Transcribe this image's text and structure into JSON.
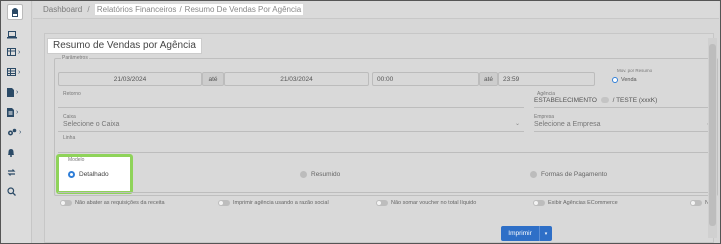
{
  "breadcrumb": {
    "root": "Dashboard",
    "separator": "/",
    "section": "Relatórios Financeiros",
    "current": "Resumo De Vendas Por Agência"
  },
  "page": {
    "title": "Resumo de Vendas por Agência"
  },
  "parametros": {
    "legend": "Parâmetros",
    "date_from": "21/03/2024",
    "date_sep": "até",
    "date_to": "21/03/2024",
    "time_from": "00:00",
    "time_sep": "até",
    "time_to": "23:59",
    "mov_legend": "Mov. por Resumo",
    "mov_option": "Venda",
    "retorno_label": "Retorno",
    "agencia_label": "Agência",
    "agencia_value": "ESTABELECIMENTO",
    "agencia_suffix": "/ TESTE (xxxK)",
    "caixa_label": "Caixa",
    "caixa_placeholder": "Selecione o Caixa",
    "empresa_label": "Empresa",
    "empresa_placeholder": "Selecione a Empresa",
    "linha_label": "Linha"
  },
  "modelo": {
    "legend": "Modelo",
    "options": [
      "Detalhado",
      "Resumido",
      "Formas de Pagamento"
    ],
    "selected": "Detalhado"
  },
  "toggles": [
    "Não abater as requisições da receita",
    "Imprimir agência usando a razão social",
    "Não somar voucher no total líquido",
    "Exibir Agências ECommerce",
    "Não"
  ],
  "actions": {
    "print_label": "Imprimir"
  },
  "colors": {
    "accent": "#2f7ed8",
    "highlight": "#8fd35a",
    "button": "#2e6fc7"
  }
}
